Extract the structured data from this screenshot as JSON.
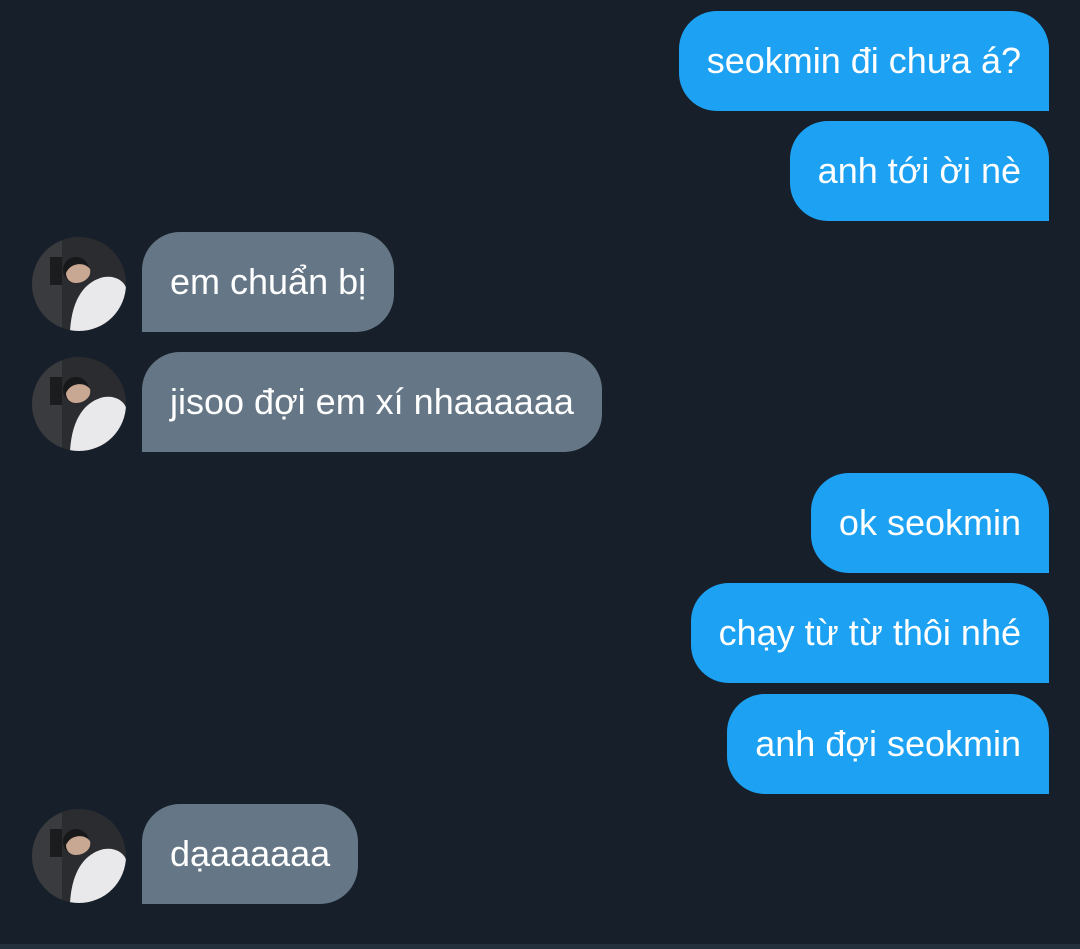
{
  "messages": [
    {
      "side": "out",
      "text": "seokmin đi chưa á?"
    },
    {
      "side": "out",
      "text": "anh tới ời nè"
    },
    {
      "side": "in",
      "text": "em chuẩn bị"
    },
    {
      "side": "in",
      "text": "jisoo đợi em xí nhaaaaaa"
    },
    {
      "side": "out",
      "text": "ok seokmin"
    },
    {
      "side": "out",
      "text": "chạy từ từ thôi nhé"
    },
    {
      "side": "out",
      "text": "anh đợi seokmin"
    },
    {
      "side": "in",
      "text": "dạaaaaaa"
    }
  ],
  "colors": {
    "background": "#17202a",
    "outgoing_bubble": "#1da1f2",
    "incoming_bubble": "#657786",
    "text": "#ffffff"
  }
}
